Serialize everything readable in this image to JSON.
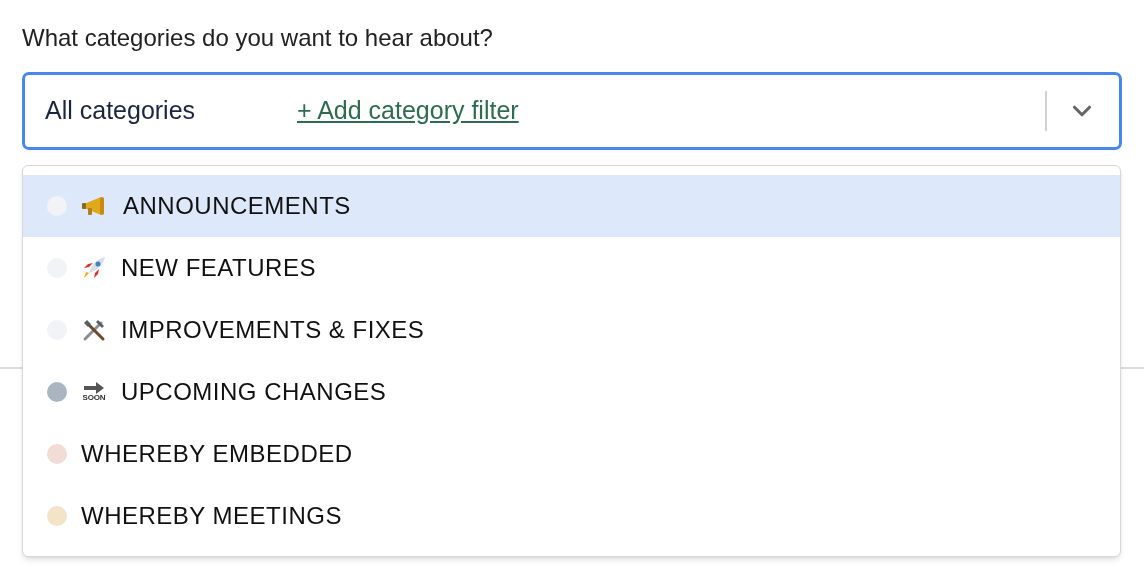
{
  "question": "What categories do you want to hear about?",
  "select": {
    "value": "All categories",
    "add_link": "+ Add category filter",
    "expanded": true
  },
  "options": [
    {
      "label": "ANNOUNCEMENTS",
      "kind": "megaphone",
      "color": "#f1f3f6",
      "selected": true
    },
    {
      "label": "NEW FEATURES",
      "kind": "rocket",
      "color": "#f1f3f6",
      "selected": false
    },
    {
      "label": "IMPROVEMENTS & FIXES",
      "kind": "tools",
      "color": "#f1f3f6",
      "selected": false
    },
    {
      "label": "UPCOMING CHANGES",
      "kind": "soon",
      "icon_label": "SOON",
      "color": "#aab5c3",
      "selected": false
    },
    {
      "label": "WHEREBY EMBEDDED",
      "kind": "plain",
      "color": "#f1dcd6",
      "selected": false
    },
    {
      "label": "WHEREBY MEETINGS",
      "kind": "plain",
      "color": "#f3e3c7",
      "selected": false
    }
  ]
}
